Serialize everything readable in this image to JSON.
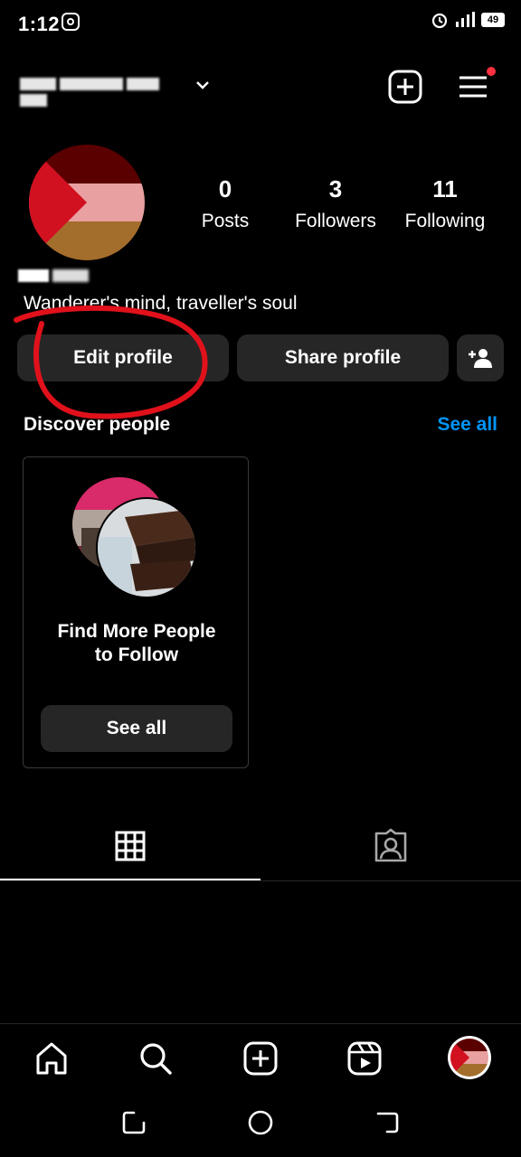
{
  "status_bar": {
    "time": "1:12",
    "battery": "49",
    "icons": [
      "instagram-icon",
      "alarm-icon",
      "signal-icon",
      "battery-icon"
    ]
  },
  "header": {
    "username": "",
    "icons": [
      "chevron-down-icon",
      "new-post-icon",
      "menu-icon"
    ],
    "notification_color": "#ff3040"
  },
  "profile": {
    "stats": [
      {
        "value": "0",
        "label": "Posts"
      },
      {
        "value": "3",
        "label": "Followers"
      },
      {
        "value": "11",
        "label": "Following"
      }
    ],
    "bio": "Wanderer's mind, traveller's soul",
    "avatar_colors": [
      "#5a0000",
      "#e8a0a0",
      "#a36d2c",
      "#d11020"
    ]
  },
  "actions": {
    "edit_profile": "Edit profile",
    "share_profile": "Share profile",
    "add_person_icon": "person-add-icon"
  },
  "discover": {
    "title": "Discover people",
    "see_all": "See all",
    "card_title_line1": "Find More People",
    "card_title_line2": "to Follow",
    "card_button": "See all"
  },
  "tabs": {
    "icons": [
      "grid-icon",
      "tagged-icon"
    ]
  },
  "bottom_nav": {
    "icons": [
      "home-icon",
      "search-icon",
      "create-icon",
      "reels-icon",
      "profile-avatar"
    ]
  },
  "colors": {
    "background": "#000000",
    "button": "#262626",
    "link": "#0095f6",
    "annotation": "#e0111b"
  }
}
